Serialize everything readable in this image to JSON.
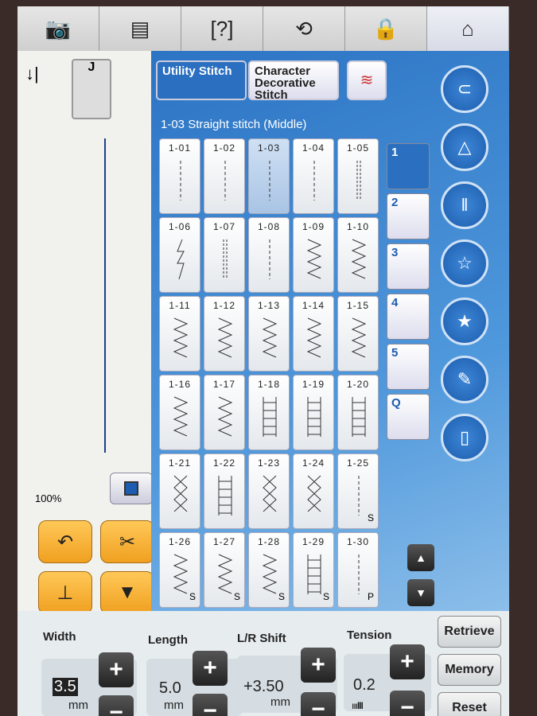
{
  "top_bar": [
    {
      "name": "camera-icon",
      "glyph": "📷"
    },
    {
      "name": "document-icon",
      "glyph": "▤"
    },
    {
      "name": "help-video-icon",
      "glyph": "[?]"
    },
    {
      "name": "needle-change-icon",
      "glyph": "⟲"
    },
    {
      "name": "lock-icon",
      "glyph": "🔒"
    },
    {
      "name": "home-icon",
      "glyph": "⌂"
    }
  ],
  "modes": {
    "utility": "Utility Stitch",
    "character": "Character Decorative Stitch"
  },
  "title": "1-03 Straight stitch (Middle)",
  "stitches": [
    {
      "label": "1-01",
      "p": "straight"
    },
    {
      "label": "1-02",
      "p": "straight"
    },
    {
      "label": "1-03",
      "p": "straight",
      "selected": true
    },
    {
      "label": "1-04",
      "p": "straight"
    },
    {
      "label": "1-05",
      "p": "triple"
    },
    {
      "label": "1-06",
      "p": "zig"
    },
    {
      "label": "1-07",
      "p": "triple"
    },
    {
      "label": "1-08",
      "p": "straight"
    },
    {
      "label": "1-09",
      "p": "zigzag"
    },
    {
      "label": "1-10",
      "p": "zigzag"
    },
    {
      "label": "1-11",
      "p": "zigzag"
    },
    {
      "label": "1-12",
      "p": "zigzag"
    },
    {
      "label": "1-13",
      "p": "zigzag"
    },
    {
      "label": "1-14",
      "p": "zigzag"
    },
    {
      "label": "1-15",
      "p": "zigzag"
    },
    {
      "label": "1-16",
      "p": "zigzag"
    },
    {
      "label": "1-17",
      "p": "zigzag"
    },
    {
      "label": "1-18",
      "p": "ladder"
    },
    {
      "label": "1-19",
      "p": "ladder"
    },
    {
      "label": "1-20",
      "p": "ladder"
    },
    {
      "label": "1-21",
      "p": "cross"
    },
    {
      "label": "1-22",
      "p": "ladder"
    },
    {
      "label": "1-23",
      "p": "cross"
    },
    {
      "label": "1-24",
      "p": "cross"
    },
    {
      "label": "1-25",
      "p": "straight",
      "suffix": "S"
    },
    {
      "label": "1-26",
      "p": "zigzag",
      "suffix": "S"
    },
    {
      "label": "1-27",
      "p": "zigzag",
      "suffix": "S"
    },
    {
      "label": "1-28",
      "p": "zigzag",
      "suffix": "S"
    },
    {
      "label": "1-29",
      "p": "ladder",
      "suffix": "S"
    },
    {
      "label": "1-30",
      "p": "straight",
      "suffix": "P"
    }
  ],
  "categories": [
    {
      "label": "1",
      "selected": true
    },
    {
      "label": "2"
    },
    {
      "label": "3"
    },
    {
      "label": "4"
    },
    {
      "label": "5"
    },
    {
      "label": "Q"
    }
  ],
  "round_buttons": [
    "threading-icon",
    "mirror-icon",
    "twin-needle-icon",
    "stitch-combine-icon",
    "stars-icon",
    "pencil-icon",
    "presser-foot-icon"
  ],
  "zoom": "100%",
  "params": {
    "width": {
      "label": "Width",
      "value": "3.5",
      "unit": "mm"
    },
    "length": {
      "label": "Length",
      "value": "5.0",
      "unit": "mm"
    },
    "shift": {
      "label": "L/R Shift",
      "value": "+3.50",
      "unit": "mm"
    },
    "tension": {
      "label": "Tension",
      "value": "0.2"
    }
  },
  "side_buttons": {
    "retrieve": "Retrieve",
    "memory": "Memory",
    "reset": "Reset"
  },
  "colors": {
    "accent": "#2c74c4",
    "orange": "#f0a020"
  }
}
